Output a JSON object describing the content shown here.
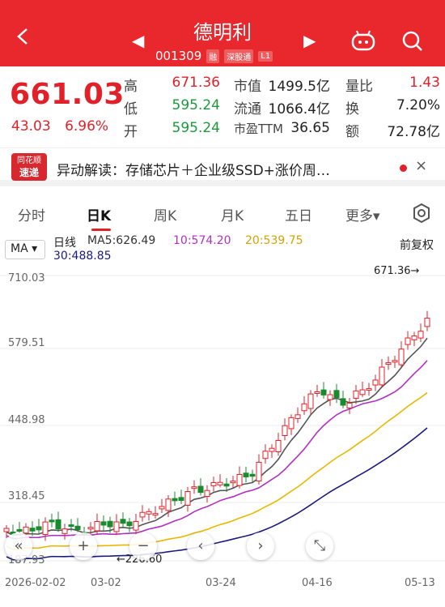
{
  "header": {
    "stock_name": "德明利",
    "stock_code": "001309",
    "tags": [
      "融",
      "深股通",
      "L1"
    ],
    "prev_arrow": "◀",
    "next_arrow": "▶"
  },
  "quote": {
    "price": "661.03",
    "change": "43.03",
    "change_pct": "6.96%",
    "high_label": "高",
    "high": "671.36",
    "low_label": "低",
    "low": "595.24",
    "open_label": "开",
    "open": "595.24",
    "mktcap_label": "市值",
    "mktcap": "1499.5亿",
    "float_label": "流通",
    "float": "1066.4亿",
    "pe_label": "市盈TTM",
    "pe": "36.65",
    "volratio_label": "量比",
    "volratio": "1.43",
    "turnover_label": "换",
    "turnover": "7.20%",
    "amount_label": "额",
    "amount": "72.78亿"
  },
  "news": {
    "logo_top": "同花顺",
    "logo_bottom": "速递",
    "text": "异动解读：存储芯片＋企业级SSD+涨价周…",
    "close": "×"
  },
  "tabs": [
    "分时",
    "日K",
    "周K",
    "月K",
    "五日",
    "更多▾"
  ],
  "indicators": {
    "selector": "MA ▾",
    "period": "日线",
    "ma5": "MA5:626.49",
    "ma10": "10:574.20",
    "ma20": "20:539.75",
    "ma30": "30:488.85",
    "adjust": "前复权"
  },
  "chart_data": {
    "type": "candlestick",
    "y_ticks": [
      "710.03",
      "579.51",
      "448.98",
      "318.45",
      "187.93"
    ],
    "x_ticks": [
      "2026-02-02",
      "03-02",
      "03-24",
      "04-16",
      "05-13"
    ],
    "max_annotation": "671.36→",
    "min_annotation": "←226.60",
    "colors": {
      "up": "#e0212a",
      "down": "#1a8a2e",
      "ma5": "#555555",
      "ma10": "#b030c0",
      "ma20": "#e8b800",
      "ma30": "#1a1a80"
    }
  },
  "controls": [
    "«",
    "+",
    "−",
    "‹",
    "›",
    "⤡"
  ]
}
